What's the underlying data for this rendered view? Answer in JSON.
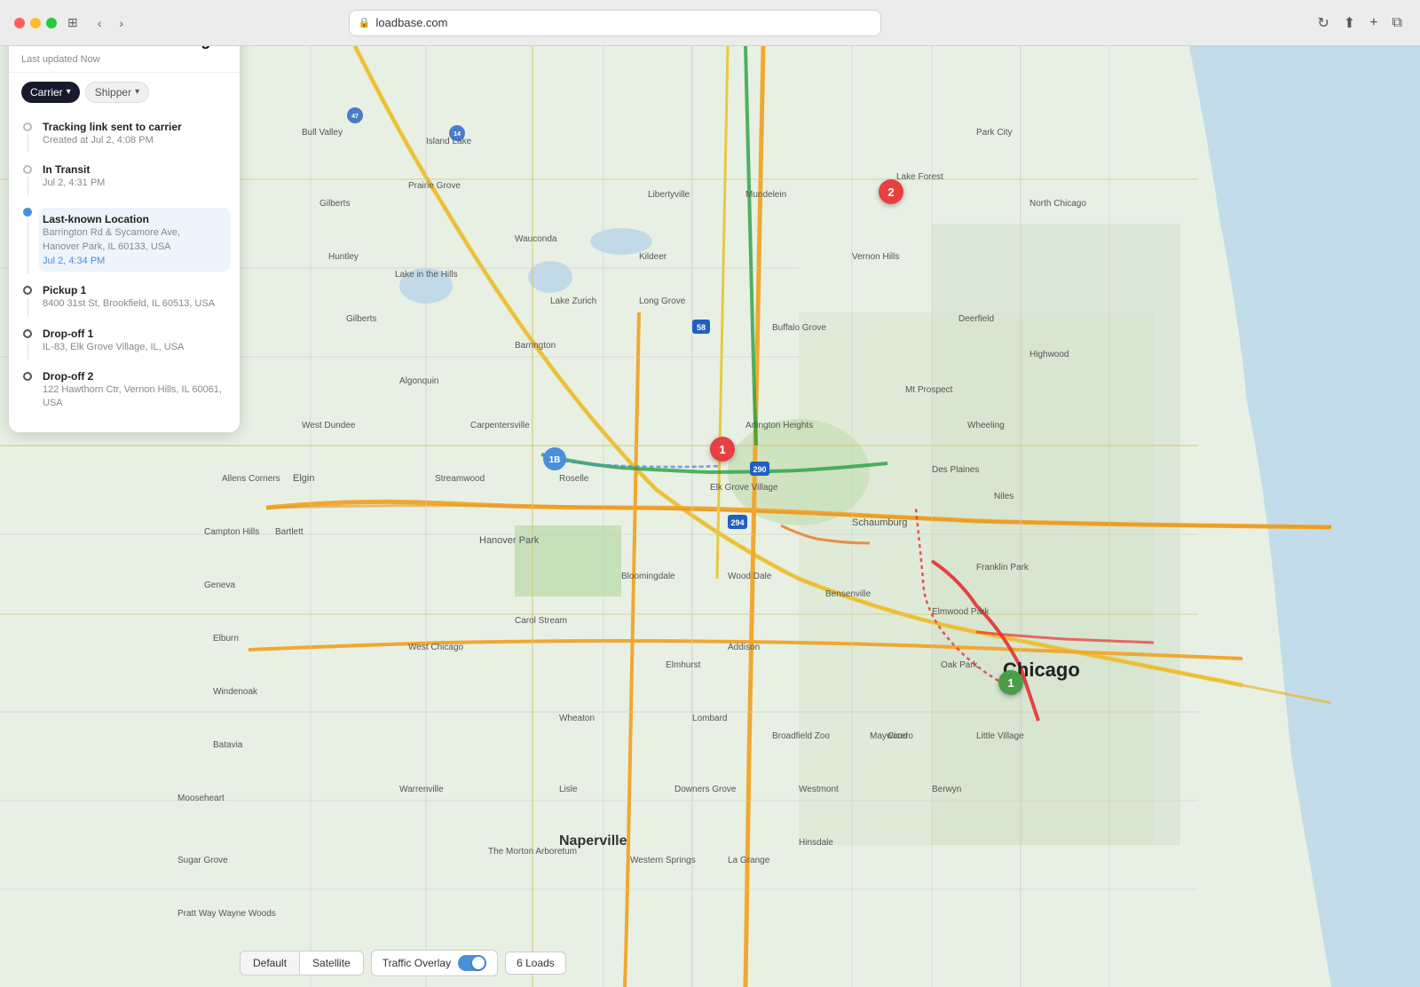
{
  "browser": {
    "url": "loadbase.com",
    "shield_icon": "🛡",
    "reload_icon": "↻"
  },
  "sidebar": {
    "title": "Great American Trucking",
    "subtitle": "Last updated Now",
    "drag_handle": "",
    "header_icons": {
      "refresh": "↻",
      "more": "•••",
      "close": "✕"
    },
    "tabs": [
      {
        "label": "Carrier",
        "active": true
      },
      {
        "label": "Shipper",
        "active": false
      }
    ],
    "timeline": [
      {
        "id": "tracking-link",
        "title": "Tracking link sent to carrier",
        "description": "Created at Jul 2, 4:08 PM",
        "time": "",
        "dot_type": "gray",
        "highlight": false
      },
      {
        "id": "in-transit",
        "title": "In Transit",
        "description": "Jul 2, 4:31 PM",
        "time": "",
        "dot_type": "gray",
        "highlight": false
      },
      {
        "id": "last-known",
        "title": "Last-known Location",
        "description": "Barrington Rd & Sycamore Ave,\nHanover Park, IL 60133, USA",
        "time": "Jul 2, 4:34 PM",
        "dot_type": "blue",
        "highlight": true
      },
      {
        "id": "pickup-1",
        "title": "Pickup 1",
        "description": "8400 31st St, Brookfield, IL 60513, USA",
        "time": "",
        "dot_type": "dark",
        "highlight": false
      },
      {
        "id": "dropoff-1",
        "title": "Drop-off 1",
        "description": "IL-83, Elk Grove Village, IL, USA",
        "time": "",
        "dot_type": "dark",
        "highlight": false
      },
      {
        "id": "dropoff-2",
        "title": "Drop-off 2",
        "description": "122 Hawthorn Ctr, Vernon Hills, IL 60061, USA",
        "time": "",
        "dot_type": "dark",
        "highlight": false
      }
    ]
  },
  "map_controls": {
    "default_label": "Default",
    "satellite_label": "Satellite",
    "traffic_label": "Traffic Overlay",
    "loads_label": "6 Loads",
    "traffic_on": true
  },
  "markers": [
    {
      "id": "marker-1",
      "type": "red",
      "label": "1",
      "left": "780",
      "top": "445"
    },
    {
      "id": "marker-2",
      "type": "red",
      "label": "2",
      "left": "980",
      "top": "155"
    },
    {
      "id": "marker-green-1",
      "type": "green",
      "label": "1",
      "left": "1120",
      "top": "710"
    },
    {
      "id": "marker-truck",
      "type": "truck",
      "label": "1b",
      "left": "610",
      "top": "460"
    }
  ]
}
